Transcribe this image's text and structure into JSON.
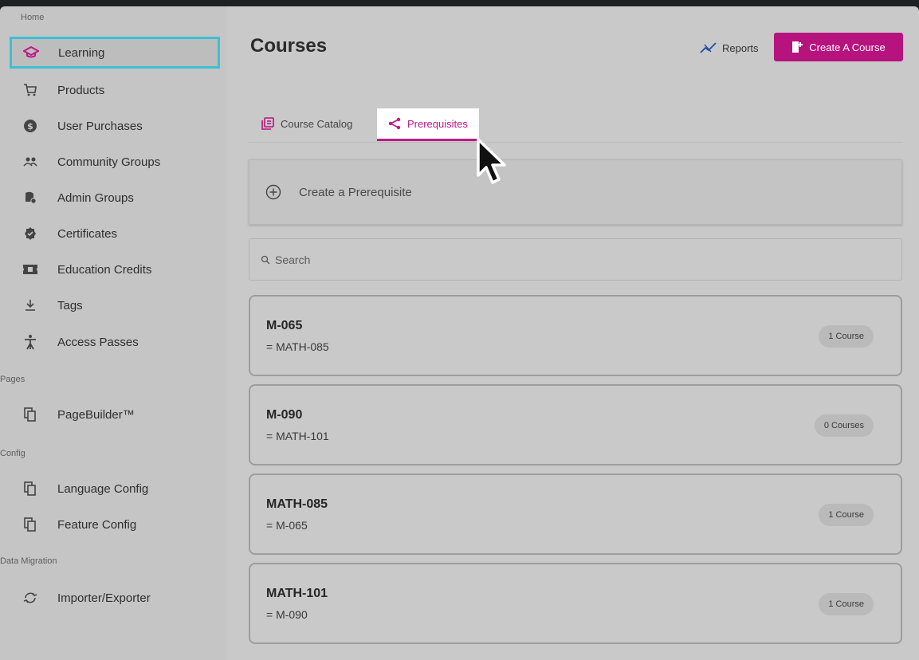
{
  "sidebar": {
    "sections": {
      "home": "Home",
      "pages": "Pages",
      "config": "Config",
      "data_migration": "Data Migration"
    },
    "items": [
      {
        "label": "Learning",
        "icon": "graduation-cap-icon",
        "active": true
      },
      {
        "label": "Products",
        "icon": "cart-icon"
      },
      {
        "label": "User Purchases",
        "icon": "dollar-circle-icon"
      },
      {
        "label": "Community Groups",
        "icon": "group-icon"
      },
      {
        "label": "Admin Groups",
        "icon": "admin-group-icon"
      },
      {
        "label": "Certificates",
        "icon": "certificate-icon"
      },
      {
        "label": "Education Credits",
        "icon": "ticket-icon"
      },
      {
        "label": "Tags",
        "icon": "download-tag-icon"
      },
      {
        "label": "Access Passes",
        "icon": "accessibility-icon"
      },
      {
        "label": "PageBuilder™",
        "icon": "copy-pages-icon"
      },
      {
        "label": "Language Config",
        "icon": "copy-pages-icon"
      },
      {
        "label": "Feature Config",
        "icon": "copy-pages-icon"
      },
      {
        "label": "Importer/Exporter",
        "icon": "sync-icon"
      }
    ]
  },
  "header": {
    "title": "Courses",
    "reports_label": "Reports",
    "create_course_label": "Create A Course"
  },
  "tabs": [
    {
      "label": "Course Catalog",
      "active": false
    },
    {
      "label": "Prerequisites",
      "active": true
    }
  ],
  "create_prerequisite_label": "Create a Prerequisite",
  "search": {
    "placeholder": "Search",
    "value": ""
  },
  "prerequisites": [
    {
      "code": "M-065",
      "equivalent": "= MATH-085",
      "count": "1 Course"
    },
    {
      "code": "M-090",
      "equivalent": "= MATH-101",
      "count": "0 Courses"
    },
    {
      "code": "MATH-085",
      "equivalent": "= M-065",
      "count": "1 Course"
    },
    {
      "code": "MATH-101",
      "equivalent": "= M-090",
      "count": "1 Course"
    }
  ],
  "colors": {
    "accent": "#c01887",
    "button_bg": "#b6137f",
    "active_outline": "#3bc0d4"
  }
}
